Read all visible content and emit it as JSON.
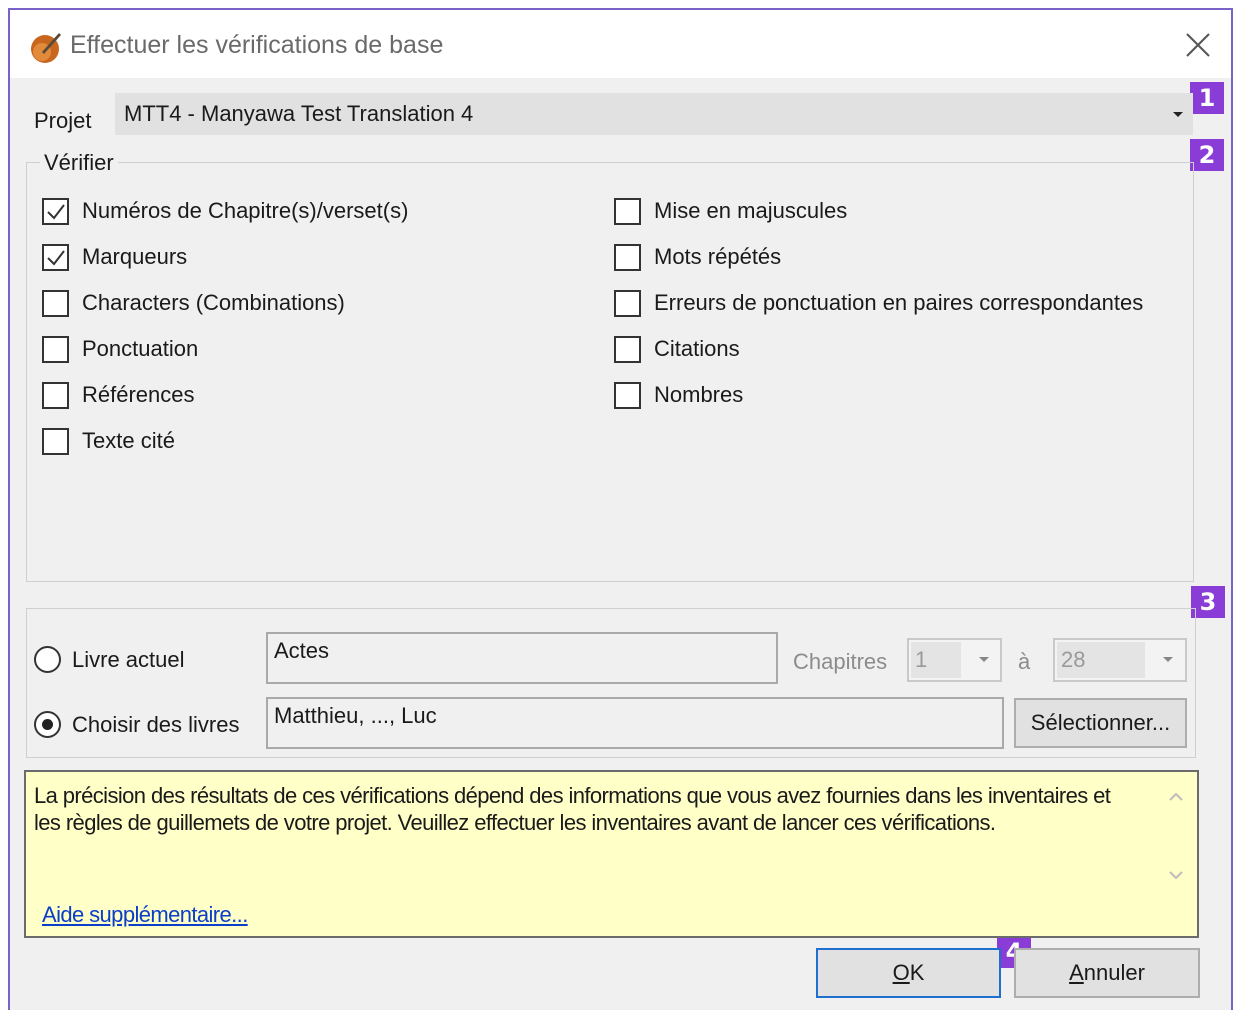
{
  "window": {
    "title": "Effectuer les vérifications de base"
  },
  "badges": [
    "1",
    "2",
    "3",
    "4"
  ],
  "project": {
    "label": "Projet",
    "value": "MTT4 -  Manyawa Test Translation 4"
  },
  "verify": {
    "title": "Vérifier",
    "left_items": [
      {
        "label": "Numéros de Chapitre(s)/verset(s)",
        "checked": true
      },
      {
        "label": "Marqueurs",
        "checked": true
      },
      {
        "label": "Characters (Combinations)",
        "checked": false
      },
      {
        "label": "Ponctuation",
        "checked": false
      },
      {
        "label": "Références",
        "checked": false
      },
      {
        "label": "Texte cité",
        "checked": false
      }
    ],
    "right_items": [
      {
        "label": "Mise en majuscules",
        "checked": false
      },
      {
        "label": "Mots répétés",
        "checked": false
      },
      {
        "label": "Erreurs de ponctuation en paires correspondantes",
        "checked": false
      },
      {
        "label": "Citations",
        "checked": false
      },
      {
        "label": "Nombres",
        "checked": false
      }
    ]
  },
  "scope": {
    "current_book_label": "Livre actuel",
    "current_book_value": "Actes",
    "chapters_label": "Chapitres",
    "chapter_from": "1",
    "to_label": "à",
    "chapter_to": "28",
    "choose_books_label": "Choisir des livres",
    "choose_books_value": "Matthieu, ..., Luc",
    "select_button": "Sélectionner...",
    "selected_option": "choose_books"
  },
  "info": {
    "text": "La précision des résultats de ces vérifications dépend des informations que vous avez fournies dans les inventaires et les règles de guillemets de votre projet. Veuillez effectuer les inventaires avant de lancer ces vérifications.",
    "help_link": "Aide supplémentaire..."
  },
  "buttons": {
    "ok_mnemonic": "O",
    "ok_rest": "K",
    "cancel_mnemonic": "A",
    "cancel_rest": "nnuler"
  },
  "colors": {
    "badge": "#8a3cd6",
    "info_background": "#ffffc8",
    "link": "#0b3ec9",
    "default_button_border": "#1f6fd1"
  }
}
